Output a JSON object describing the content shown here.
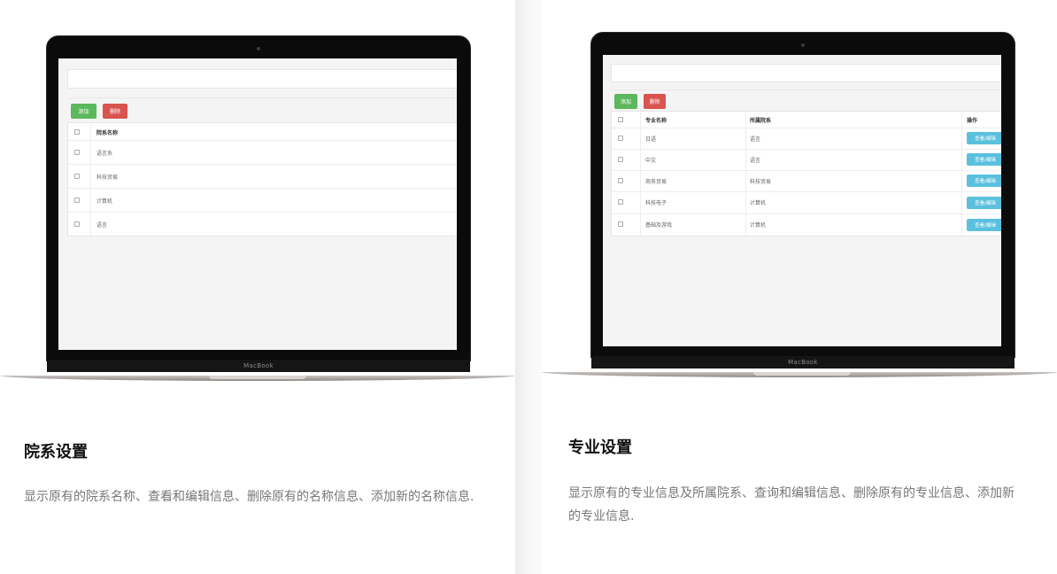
{
  "left_card": {
    "title": "院系设置",
    "description": "显示原有的院系名称、查看和编辑信息、删除原有的名称信息、添加新的名称信息.",
    "laptop_brand": "MacBook",
    "app": {
      "add_label": "添加",
      "delete_label": "删除",
      "header": "院系名称",
      "rows": [
        "语言系",
        "科技贸易",
        "计算机",
        "语言"
      ]
    }
  },
  "right_card": {
    "title": "专业设置",
    "description": "显示原有的专业信息及所属院系、查询和编辑信息、删除原有的专业信息、添加新的专业信息.",
    "laptop_brand": "MacBook",
    "app": {
      "add_label": "添加",
      "delete_label": "删除",
      "headers": [
        "专业名称",
        "所属院系",
        "操作"
      ],
      "view_edit_label": "查看/编辑",
      "rows": [
        {
          "major": "日语",
          "dept": "语言"
        },
        {
          "major": "中文",
          "dept": "语言"
        },
        {
          "major": "商务贸易",
          "dept": "科技贸易"
        },
        {
          "major": "科技电子",
          "dept": "计算机"
        },
        {
          "major": "基础及游戏",
          "dept": "计算机"
        }
      ]
    }
  },
  "colors": {
    "add_button": "#5cb85c",
    "delete_button": "#d9534f",
    "view_button": "#5bc0de"
  }
}
